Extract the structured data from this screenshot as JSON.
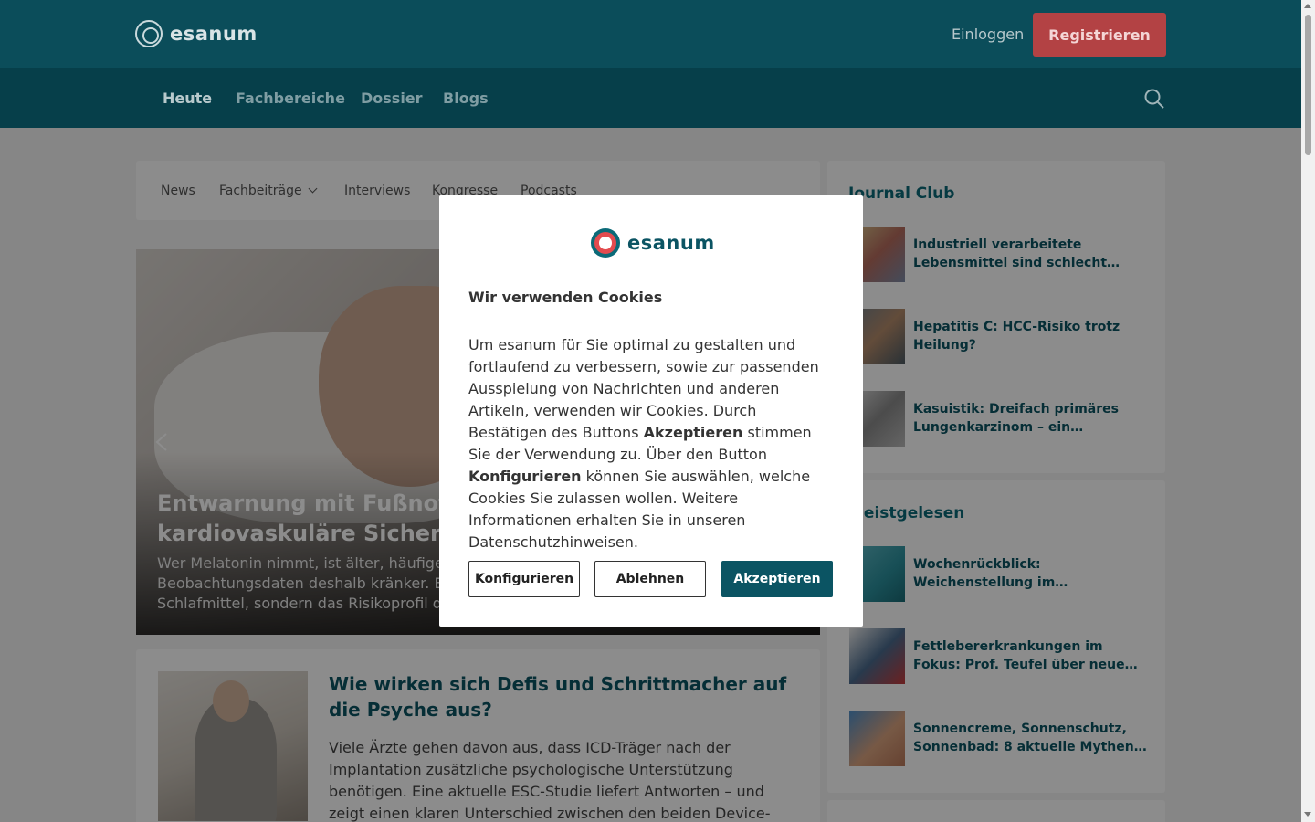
{
  "header": {
    "logo_text": "esanum",
    "login_label": "Einloggen",
    "register_label": "Registrieren"
  },
  "nav": {
    "items": [
      {
        "label": "Heute",
        "active": true
      },
      {
        "label": "Fachbereiche",
        "active": false
      },
      {
        "label": "Dossier",
        "active": false
      },
      {
        "label": "Blogs",
        "active": false
      }
    ]
  },
  "subnav": {
    "items": [
      "News",
      "Fachbeiträge",
      "Interviews",
      "Kongresse",
      "Podcasts"
    ]
  },
  "hero": {
    "title_line1": "Entwarnung mit Fußnote:",
    "title_line2": "kardiovaskuläre Sicherhei",
    "text_line1": "Wer Melatonin nimmt, ist älter, häufiger h",
    "text_line2": "Beobachtungsdaten deshalb kränker. Eine",
    "text_line3": "Schlafmittel, sondern das Risikoprofil der"
  },
  "article": {
    "title": "Wie wirken sich Defis und Schrittmacher auf die Psyche aus?",
    "text": "Viele Ärzte gehen davon aus, dass ICD-Träger nach der Implantation zusätzliche psychologische Unterstützung benötigen. Eine aktuelle ESC-Studie liefert Antworten – und zeigt einen klaren Unterschied zwischen den beiden Device-Typen."
  },
  "journal_club": {
    "title": "Journal Club",
    "items": [
      "Industriell verarbeitete Lebensmittel sind schlecht fürs…",
      "Hepatitis C: HCC-Risiko trotz Heilung?",
      "Kasuistik: Dreifach primäres Lungenkarzinom – ein…"
    ]
  },
  "meistgelesen": {
    "title": "Meistgelesen",
    "items": [
      "Wochenrückblick: Weichenstellung im…",
      "Fettlebererkrankungen im Fokus: Prof. Teufel über neue Therapien…",
      "Sonnencreme, Sonnenschutz, Sonnenbad: 8 aktuelle Mythen…"
    ]
  },
  "cookie_modal": {
    "logo_text": "esanum",
    "heading": "Wir verwenden Cookies",
    "body_part1": "Um esanum für Sie optimal zu gestalten und fortlaufend zu verbessern, sowie zur passenden Ausspielung von Nachrichten und anderen Artikeln, verwenden wir Cookies. Durch Bestätigen des Buttons ",
    "body_bold1": "Akzeptieren",
    "body_part2": " stimmen Sie der Verwendung zu. Über den Button ",
    "body_bold2": "Konfigurieren",
    "body_part3": " können Sie auswählen, welche Cookies Sie zulassen wollen. Weitere Informationen erhalten Sie in unseren Datenschutzhinweisen.",
    "configure_label": "Konfigurieren",
    "reject_label": "Ablehnen",
    "accept_label": "Akzeptieren"
  },
  "colors": {
    "topbar": "#0b4d5a",
    "navbar": "#063f4a",
    "accent": "#0b5463",
    "register": "#b34244"
  }
}
